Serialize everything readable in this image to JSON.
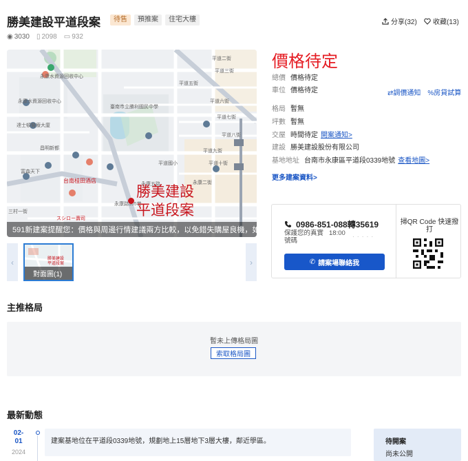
{
  "header": {
    "title": "勝美建設平道段案",
    "tags": [
      "待售",
      "預推案",
      "住宅大樓"
    ],
    "share_label": "分享(32)",
    "fav_label": "收藏(13)"
  },
  "stats": {
    "views": "3030",
    "saves": "2098",
    "comments": "932"
  },
  "map": {
    "marker_text_1": "勝美建設",
    "marker_text_2": "平道段案",
    "caption": "591新建案提醒您：價格與周邊行情建議兩方比較，以免錯失購屋良機，如有疑問請洽詢建案，以建案合約為準。",
    "labels": {
      "l1": "平道二街",
      "l2": "平道三街",
      "l3": "平道五街",
      "l4": "平道六街",
      "l5": "平道七街",
      "l6": "平道八街",
      "l7": "平道九街",
      "l8": "平道十街",
      "l9": "平道十一街",
      "l10": "永康水資源回收中心",
      "l11": "臺南市立勝利國民中學",
      "l12": "平道國小",
      "l13": "永安路",
      "l14": "永康五路",
      "l15": "永康二街",
      "l16": "台南桂田酒店",
      "l17": "永康路105巷",
      "l18": "永康國小",
      "l19": "スシロー壽司",
      "l20": "三村一街",
      "l21": "富森天下",
      "l22": "永康長榮公園",
      "l23": "昌明新都",
      "l24": "達士頓醫療大廈",
      "l25": "家樂福",
      "l26": "永康公園",
      "l27": "全聯福利中心"
    }
  },
  "gallery": {
    "thumb_label": "對面圖(1)",
    "thumb_mark": "勝美建設\n平道段案"
  },
  "price": {
    "headline": "價格待定",
    "rows": [
      {
        "k": "總價",
        "v": "價格待定"
      },
      {
        "k": "車位",
        "v": "價格待定"
      }
    ],
    "tools": [
      "調價通知",
      "房貸試算"
    ]
  },
  "info": {
    "rows": [
      {
        "k": "格局",
        "v": "暫無"
      },
      {
        "k": "坪數",
        "v": "暫無"
      },
      {
        "k": "交屋",
        "v": "時間待定",
        "link": "開案通知>"
      },
      {
        "k": "建設",
        "v": "勝美建設股份有限公司"
      },
      {
        "k": "基地地址",
        "v": "台南市永康區平道段0339地號",
        "link": "查看地圖>"
      }
    ],
    "more_link": "更多建案資料>"
  },
  "contact": {
    "phone": "0986-851-088轉35619",
    "privacy_line1": "保護您的真實",
    "privacy_line2": "號碼",
    "hours": "18:00",
    "dots": "· · · · ·",
    "call_button": "請案場聯絡我",
    "qr_title": "掃QR Code 快速撥打"
  },
  "plans": {
    "section_title": "主推格局",
    "empty_text": "暫未上傳格局圖",
    "request_button": "索取格局圖"
  },
  "news": {
    "section_title": "最新動態",
    "date_md": "02-01",
    "date_m": "02-",
    "date_d": "01",
    "year": "2024",
    "text": "建案基地位在平道段0339地號，規劃地上15層地下3層大樓，鄰近學區。",
    "status_title": "待開案",
    "status_value": "尚未公開"
  },
  "colors": {
    "accent": "#1857c9",
    "price": "#e51c23",
    "status_tag_bg": "#fbe7d2"
  }
}
